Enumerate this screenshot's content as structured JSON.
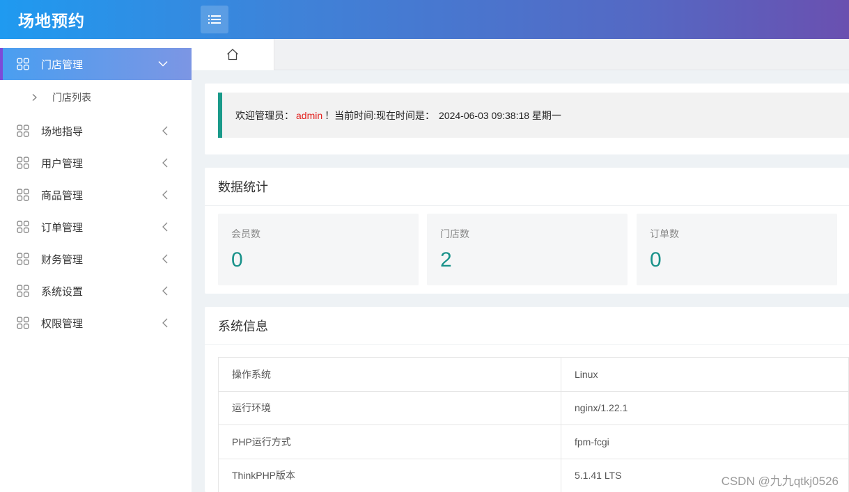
{
  "header": {
    "brand": "场地预约",
    "menu_toggle_icon": "list-icon"
  },
  "sidebar": {
    "items": [
      {
        "label": "门店管理",
        "icon": "grid-icon",
        "expanded": true,
        "children": [
          {
            "label": "门店列表"
          }
        ]
      },
      {
        "label": "场地指导",
        "icon": "grid-icon"
      },
      {
        "label": "用户管理",
        "icon": "grid-icon"
      },
      {
        "label": "商品管理",
        "icon": "grid-icon"
      },
      {
        "label": "订单管理",
        "icon": "grid-icon"
      },
      {
        "label": "财务管理",
        "icon": "grid-icon"
      },
      {
        "label": "系统设置",
        "icon": "grid-icon"
      },
      {
        "label": "权限管理",
        "icon": "grid-icon"
      }
    ]
  },
  "tabs": [
    {
      "icon": "home-icon"
    }
  ],
  "welcome": {
    "prefix": "欢迎管理员：",
    "user": "admin",
    "middle": "！当前时间:现在时间是：",
    "datetime": "2024-06-03 09:38:18 星期一"
  },
  "stats": {
    "title": "数据统计",
    "items": [
      {
        "label": "会员数",
        "value": "0"
      },
      {
        "label": "门店数",
        "value": "2"
      },
      {
        "label": "订单数",
        "value": "0"
      }
    ]
  },
  "sysinfo": {
    "title": "系统信息",
    "rows": [
      {
        "key": "操作系统",
        "value": "Linux"
      },
      {
        "key": "运行环境",
        "value": "nginx/1.22.1"
      },
      {
        "key": "PHP运行方式",
        "value": "fpm-fcgi"
      },
      {
        "key": "ThinkPHP版本",
        "value": "5.1.41 LTS"
      }
    ]
  },
  "watermark": "CSDN @九九qtkj0526",
  "colors": {
    "accent_teal": "#19928a",
    "admin_red": "#e3211e",
    "header_start": "#1f9af0",
    "header_end": "#6a50b0"
  }
}
